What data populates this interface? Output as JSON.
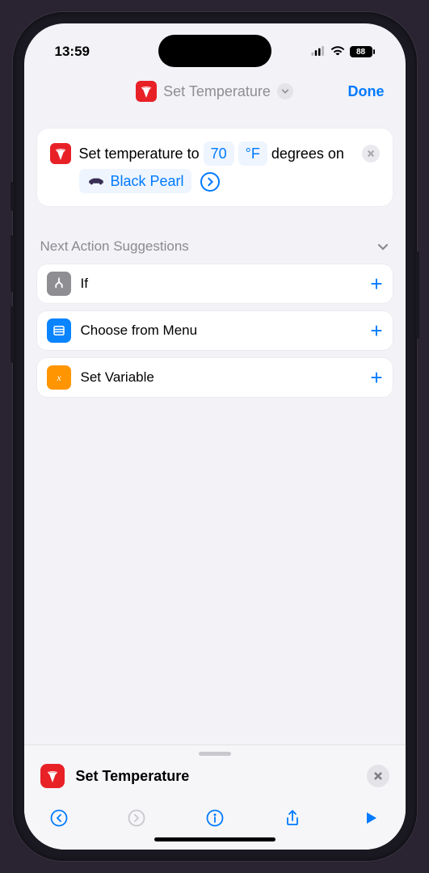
{
  "status": {
    "time": "13:59",
    "battery": "88"
  },
  "nav": {
    "title": "Set Temperature",
    "done": "Done"
  },
  "action": {
    "prefix": "Set temperature to",
    "temp": "70",
    "unit": "°F",
    "middle": "degrees on",
    "vehicle": "Black Pearl"
  },
  "suggestions": {
    "header": "Next Action Suggestions",
    "items": [
      {
        "label": "If",
        "icon": "branch",
        "bg": "#8e8e93"
      },
      {
        "label": "Choose from Menu",
        "icon": "menu",
        "bg": "#0a84ff"
      },
      {
        "label": "Set Variable",
        "icon": "var",
        "bg": "#ff9500"
      }
    ]
  },
  "sheet": {
    "title": "Set Temperature"
  }
}
